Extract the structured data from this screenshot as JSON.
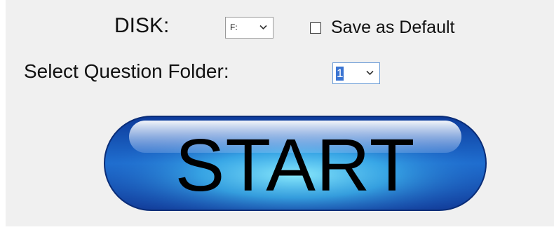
{
  "form": {
    "disk_label": "DISK:",
    "disk_value": "F:",
    "save_default_label": "Save as Default",
    "save_default_checked": false,
    "folder_label": "Select Question Folder:",
    "folder_value": "1",
    "start_label": "START"
  },
  "icons": {
    "dropdown": "chevron-down-icon",
    "checkbox": "checkbox-icon"
  },
  "colors": {
    "background": "#f0f0f0",
    "button_blue": "#1a4fb4",
    "button_highlight": "#62e0f8",
    "selection_blue": "#3a74d2"
  }
}
